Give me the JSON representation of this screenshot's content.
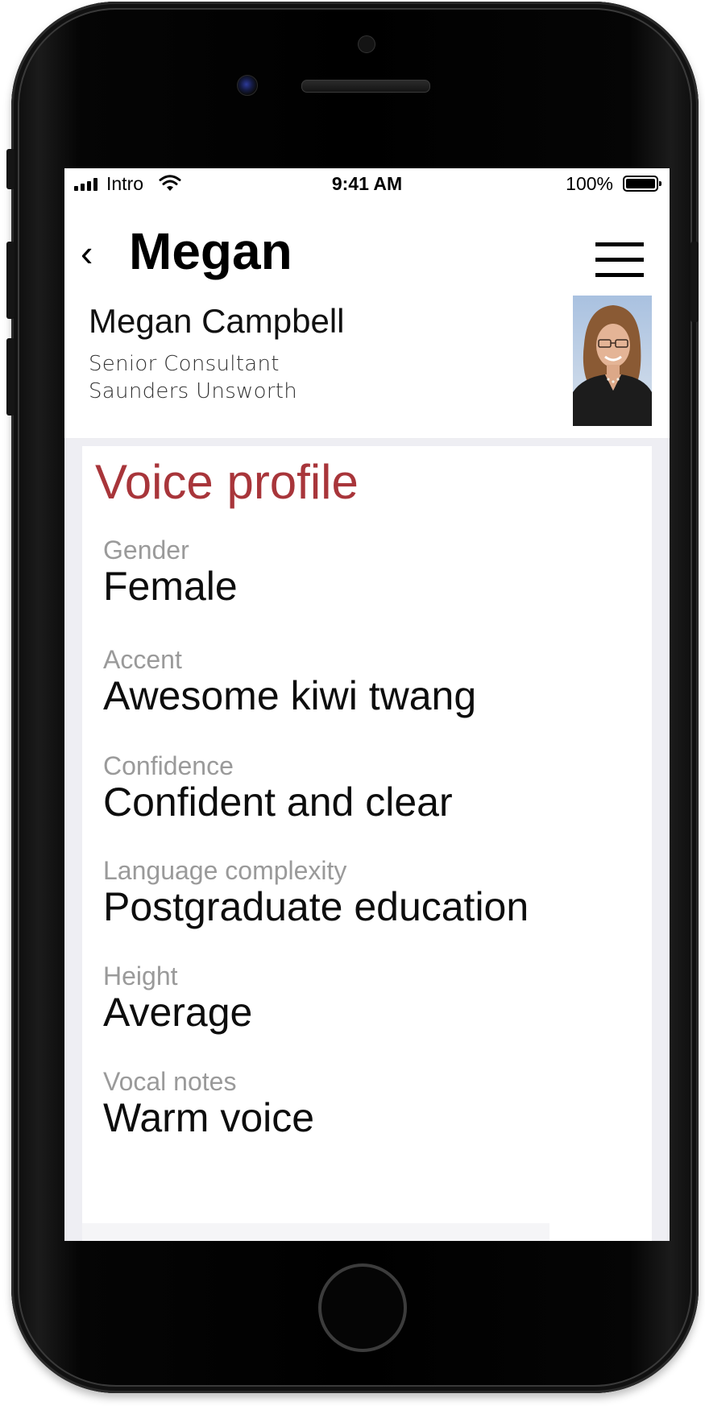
{
  "status_bar": {
    "carrier": "Intro",
    "time": "9:41 AM",
    "battery_percent": "100%"
  },
  "header": {
    "back_symbol": "‹",
    "title": "Megan"
  },
  "contact": {
    "name": "Megan Campbell",
    "role": "Senior Consultant",
    "company": "Saunders Unsworth"
  },
  "voice_profile": {
    "title": "Voice profile",
    "fields": [
      {
        "label": "Gender",
        "value": "Female"
      },
      {
        "label": "Accent",
        "value": "Awesome kiwi twang"
      },
      {
        "label": "Confidence",
        "value": "Confident and clear"
      },
      {
        "label": "Language complexity",
        "value": "Postgraduate education"
      },
      {
        "label": "Height",
        "value": "Average"
      },
      {
        "label": "Vocal notes",
        "value": "Warm voice"
      }
    ]
  },
  "colors": {
    "accent": "#a8353a",
    "label_gray": "#9a9a9a",
    "background": "#eeeef3"
  },
  "icons": [
    "signal-icon",
    "wifi-icon",
    "battery-icon",
    "back-icon",
    "hamburger-menu-icon"
  ]
}
